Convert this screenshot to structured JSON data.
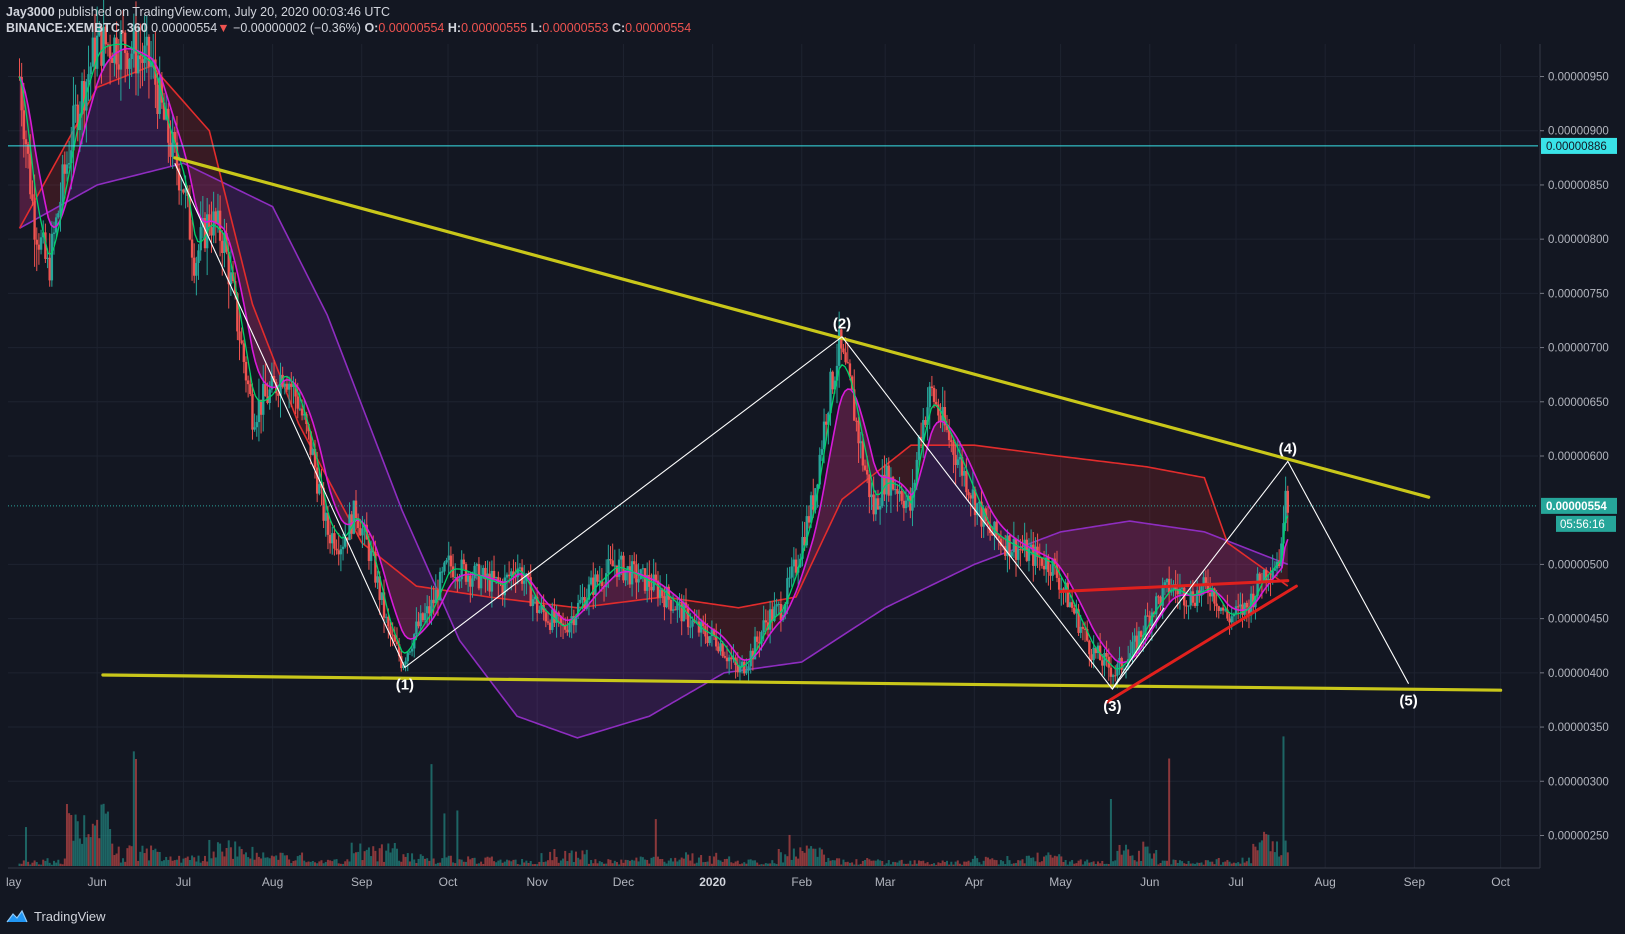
{
  "header": {
    "author": "Jay3000",
    "published": " published on TradingView.com, July 20, 2020 00:03:46 UTC",
    "symbol": "BINANCE:XEMBTC, 360",
    "last": "0.00000554",
    "change_arrow": "▼",
    "change": "−0.00000002 (−0.36%)",
    "o_label": "O:",
    "o_value": "0.00000554",
    "h_label": "H:",
    "h_value": "0.00000555",
    "l_label": "L:",
    "l_value": "0.00000553",
    "c_label": "C:",
    "c_value": "0.00000554"
  },
  "footer": {
    "brand": "TradingView",
    "logo_icon": "tradingview-logo-icon"
  },
  "colors": {
    "background": "#131722",
    "grid": "#1e2330",
    "trendline": "#c9c71a",
    "redline": "#e0201d",
    "wave": "#ffffff",
    "cyanline": "#39e3e8",
    "bull": "#26a69a",
    "bear": "#ef5350",
    "ema_fast": "#00d26a",
    "ema_mid": "#d81ad8",
    "ma_slow": "#e22c2c",
    "ma_long": "#8e2dc0"
  },
  "chart_data": {
    "type": "candlestick",
    "symbol": "BINANCE:XEMBTC",
    "interval": "360",
    "ylim": [
      2.2e-06,
      9.7e-06
    ],
    "y_ticks": [
      "0.00000950",
      "0.00000900",
      "0.00000850",
      "0.00000800",
      "0.00000750",
      "0.00000700",
      "0.00000650",
      "0.00000600",
      "0.00000500",
      "0.00000450",
      "0.00000400",
      "0.00000350",
      "0.00000300",
      "0.00000250"
    ],
    "x_ticks": [
      {
        "label": "Jun",
        "date": "2019-06-01"
      },
      {
        "label": "Jul",
        "date": "2019-07-01"
      },
      {
        "label": "Aug",
        "date": "2019-08-01"
      },
      {
        "label": "Sep",
        "date": "2019-09-01"
      },
      {
        "label": "Oct",
        "date": "2019-10-01"
      },
      {
        "label": "Nov",
        "date": "2019-11-01"
      },
      {
        "label": "Dec",
        "date": "2019-12-01"
      },
      {
        "label": "2020",
        "date": "2020-01-01"
      },
      {
        "label": "Feb",
        "date": "2020-02-01"
      },
      {
        "label": "Mar",
        "date": "2020-03-01"
      },
      {
        "label": "Apr",
        "date": "2020-04-01"
      },
      {
        "label": "May",
        "date": "2020-05-01"
      },
      {
        "label": "Jun",
        "date": "2020-06-01"
      },
      {
        "label": "Jul",
        "date": "2020-07-01"
      },
      {
        "label": "Aug",
        "date": "2020-08-01"
      },
      {
        "label": "Sep",
        "date": "2020-09-01"
      },
      {
        "label": "Oct",
        "date": "2020-10-01"
      }
    ],
    "x_left_partial_label": "lay",
    "price_path": [
      [
        "2019-05-05",
        9.5e-06
      ],
      [
        "2019-05-10",
        8.2e-06
      ],
      [
        "2019-05-15",
        7.7e-06
      ],
      [
        "2019-05-20",
        8.5e-06
      ],
      [
        "2019-05-25",
        9.2e-06
      ],
      [
        "2019-06-01",
        9.8e-06
      ],
      [
        "2019-06-10",
        9.8e-06
      ],
      [
        "2019-06-20",
        9.6e-06
      ],
      [
        "2019-06-25",
        9e-06
      ],
      [
        "2019-07-01",
        8.5e-06
      ],
      [
        "2019-07-05",
        7.8e-06
      ],
      [
        "2019-07-10",
        8.2e-06
      ],
      [
        "2019-07-15",
        8e-06
      ],
      [
        "2019-07-20",
        7.2e-06
      ],
      [
        "2019-07-25",
        6.4e-06
      ],
      [
        "2019-08-01",
        6.6e-06
      ],
      [
        "2019-08-05",
        6.8e-06
      ],
      [
        "2019-08-10",
        6.5e-06
      ],
      [
        "2019-08-15",
        6e-06
      ],
      [
        "2019-08-20",
        5.3e-06
      ],
      [
        "2019-08-25",
        5.2e-06
      ],
      [
        "2019-08-30",
        5.5e-06
      ],
      [
        "2019-09-05",
        5e-06
      ],
      [
        "2019-09-10",
        4.4e-06
      ],
      [
        "2019-09-15",
        4.1e-06
      ],
      [
        "2019-09-20",
        4.4e-06
      ],
      [
        "2019-09-25",
        4.6e-06
      ],
      [
        "2019-10-01",
        5e-06
      ],
      [
        "2019-10-10",
        4.9e-06
      ],
      [
        "2019-10-20",
        4.8e-06
      ],
      [
        "2019-10-25",
        5e-06
      ],
      [
        "2019-11-01",
        4.6e-06
      ],
      [
        "2019-11-10",
        4.4e-06
      ],
      [
        "2019-11-20",
        4.8e-06
      ],
      [
        "2019-11-28",
        5e-06
      ],
      [
        "2019-12-05",
        4.9e-06
      ],
      [
        "2019-12-12",
        4.8e-06
      ],
      [
        "2019-12-20",
        4.6e-06
      ],
      [
        "2019-12-27",
        4.4e-06
      ],
      [
        "2020-01-03",
        4.3e-06
      ],
      [
        "2020-01-10",
        4e-06
      ],
      [
        "2020-01-15",
        4.2e-06
      ],
      [
        "2020-01-20",
        4.5e-06
      ],
      [
        "2020-01-25",
        4.6e-06
      ],
      [
        "2020-01-30",
        5e-06
      ],
      [
        "2020-02-05",
        5.6e-06
      ],
      [
        "2020-02-10",
        6.5e-06
      ],
      [
        "2020-02-14",
        7e-06
      ],
      [
        "2020-02-18",
        6.6e-06
      ],
      [
        "2020-02-22",
        6e-06
      ],
      [
        "2020-02-26",
        5.5e-06
      ],
      [
        "2020-03-01",
        5.8e-06
      ],
      [
        "2020-03-06",
        5.7e-06
      ],
      [
        "2020-03-10",
        5.5e-06
      ],
      [
        "2020-03-13",
        6.2e-06
      ],
      [
        "2020-03-17",
        6.6e-06
      ],
      [
        "2020-03-21",
        6.3e-06
      ],
      [
        "2020-03-26",
        6e-06
      ],
      [
        "2020-04-01",
        5.6e-06
      ],
      [
        "2020-04-06",
        5.3e-06
      ],
      [
        "2020-04-12",
        5.2e-06
      ],
      [
        "2020-04-20",
        5.1e-06
      ],
      [
        "2020-04-28",
        5e-06
      ],
      [
        "2020-05-05",
        4.6e-06
      ],
      [
        "2020-05-12",
        4.2e-06
      ],
      [
        "2020-05-20",
        4e-06
      ],
      [
        "2020-05-26",
        4.2e-06
      ],
      [
        "2020-06-02",
        4.6e-06
      ],
      [
        "2020-06-08",
        4.8e-06
      ],
      [
        "2020-06-15",
        4.7e-06
      ],
      [
        "2020-06-22",
        4.8e-06
      ],
      [
        "2020-06-28",
        4.5e-06
      ],
      [
        "2020-07-05",
        4.6e-06
      ],
      [
        "2020-07-10",
        4.9e-06
      ],
      [
        "2020-07-14",
        5e-06
      ],
      [
        "2020-07-17",
        5.1e-06
      ],
      [
        "2020-07-18",
        5.9e-06
      ],
      [
        "2020-07-19",
        5.54e-06
      ]
    ],
    "ma_slow": [
      [
        "2019-05-05",
        8.1e-06
      ],
      [
        "2019-06-01",
        9.4e-06
      ],
      [
        "2019-06-20",
        9.6e-06
      ],
      [
        "2019-07-10",
        9e-06
      ],
      [
        "2019-07-25",
        7.4e-06
      ],
      [
        "2019-08-10",
        6.3e-06
      ],
      [
        "2019-09-01",
        5.2e-06
      ],
      [
        "2019-09-20",
        4.8e-06
      ],
      [
        "2019-10-15",
        4.7e-06
      ],
      [
        "2019-11-15",
        4.6e-06
      ],
      [
        "2019-12-15",
        4.7e-06
      ],
      [
        "2020-01-10",
        4.6e-06
      ],
      [
        "2020-01-30",
        4.7e-06
      ],
      [
        "2020-02-15",
        5.6e-06
      ],
      [
        "2020-03-10",
        6.1e-06
      ],
      [
        "2020-04-01",
        6.1e-06
      ],
      [
        "2020-04-30",
        6e-06
      ],
      [
        "2020-05-31",
        5.9e-06
      ],
      [
        "2020-06-20",
        5.8e-06
      ],
      [
        "2020-06-28",
        5.2e-06
      ],
      [
        "2020-07-19",
        4.8e-06
      ]
    ],
    "ma_long": [
      [
        "2019-05-05",
        8.1e-06
      ],
      [
        "2019-06-01",
        8.5e-06
      ],
      [
        "2019-07-01",
        8.7e-06
      ],
      [
        "2019-08-01",
        8.3e-06
      ],
      [
        "2019-08-20",
        7.3e-06
      ],
      [
        "2019-09-15",
        5.5e-06
      ],
      [
        "2019-10-05",
        4.3e-06
      ],
      [
        "2019-10-25",
        3.6e-06
      ],
      [
        "2019-11-15",
        3.4e-06
      ],
      [
        "2019-12-10",
        3.6e-06
      ],
      [
        "2020-01-05",
        4e-06
      ],
      [
        "2020-02-01",
        4.1e-06
      ],
      [
        "2020-03-01",
        4.6e-06
      ],
      [
        "2020-04-01",
        5e-06
      ],
      [
        "2020-05-01",
        5.3e-06
      ],
      [
        "2020-05-25",
        5.4e-06
      ],
      [
        "2020-06-20",
        5.3e-06
      ],
      [
        "2020-07-19",
        5e-06
      ]
    ],
    "volume_levels": [
      0.12,
      0.9,
      0.3,
      0.15,
      0.4,
      0.2,
      0.1,
      0.35,
      0.2,
      0.15,
      0.1,
      0.25,
      0.1,
      0.15,
      0.2,
      0.1,
      0.3,
      0.12,
      0.1,
      0.08,
      0.15,
      0.2,
      0.1,
      0.35,
      0.1,
      0.12,
      0.5,
      0.3,
      0.15,
      0.2,
      0.9,
      0.1,
      0.2,
      0.1,
      0.15,
      0.25,
      0.6,
      0.2
    ],
    "horizontal_lines": [
      {
        "price": 8.86e-06,
        "label": "0.00000886",
        "style": "solid",
        "color": "cyan"
      },
      {
        "price": 5.54e-06,
        "label": "0.00000554",
        "style": "dotted",
        "color": "teal"
      }
    ],
    "countdown": "05:56:16",
    "trendlines": [
      {
        "name": "upper-trendline",
        "from": [
          "2019-06-28",
          8.75e-06
        ],
        "to": [
          "2020-09-06",
          5.62e-06
        ],
        "color": "yellow"
      },
      {
        "name": "lower-trendline",
        "from": [
          "2019-06-03",
          3.98e-06
        ],
        "to": [
          "2020-10-01",
          3.84e-06
        ],
        "color": "yellow"
      },
      {
        "name": "red-trendline-flat",
        "from": [
          "2020-05-01",
          4.75e-06
        ],
        "to": [
          "2020-07-19",
          4.85e-06
        ],
        "color": "red"
      },
      {
        "name": "red-trendline-rising",
        "from": [
          "2020-05-17",
          3.73e-06
        ],
        "to": [
          "2020-07-22",
          4.8e-06
        ],
        "color": "red"
      }
    ],
    "wave_points": [
      {
        "date": "2019-06-28",
        "price": 8.7e-06,
        "label": ""
      },
      {
        "date": "2019-09-16",
        "price": 4.05e-06,
        "label": "(1)"
      },
      {
        "date": "2020-02-15",
        "price": 7.1e-06,
        "label": "(2)"
      },
      {
        "date": "2020-05-19",
        "price": 3.85e-06,
        "label": "(3)"
      },
      {
        "date": "2020-07-19",
        "price": 5.95e-06,
        "label": "(4)"
      },
      {
        "date": "2020-08-30",
        "price": 3.9e-06,
        "label": "(5)"
      }
    ],
    "wave_lower_start": {
      "date": "2020-05-19",
      "price": 3.85e-06
    },
    "wave_lower_end": {
      "date": "2020-06-06",
      "price": 4.6e-06
    }
  }
}
